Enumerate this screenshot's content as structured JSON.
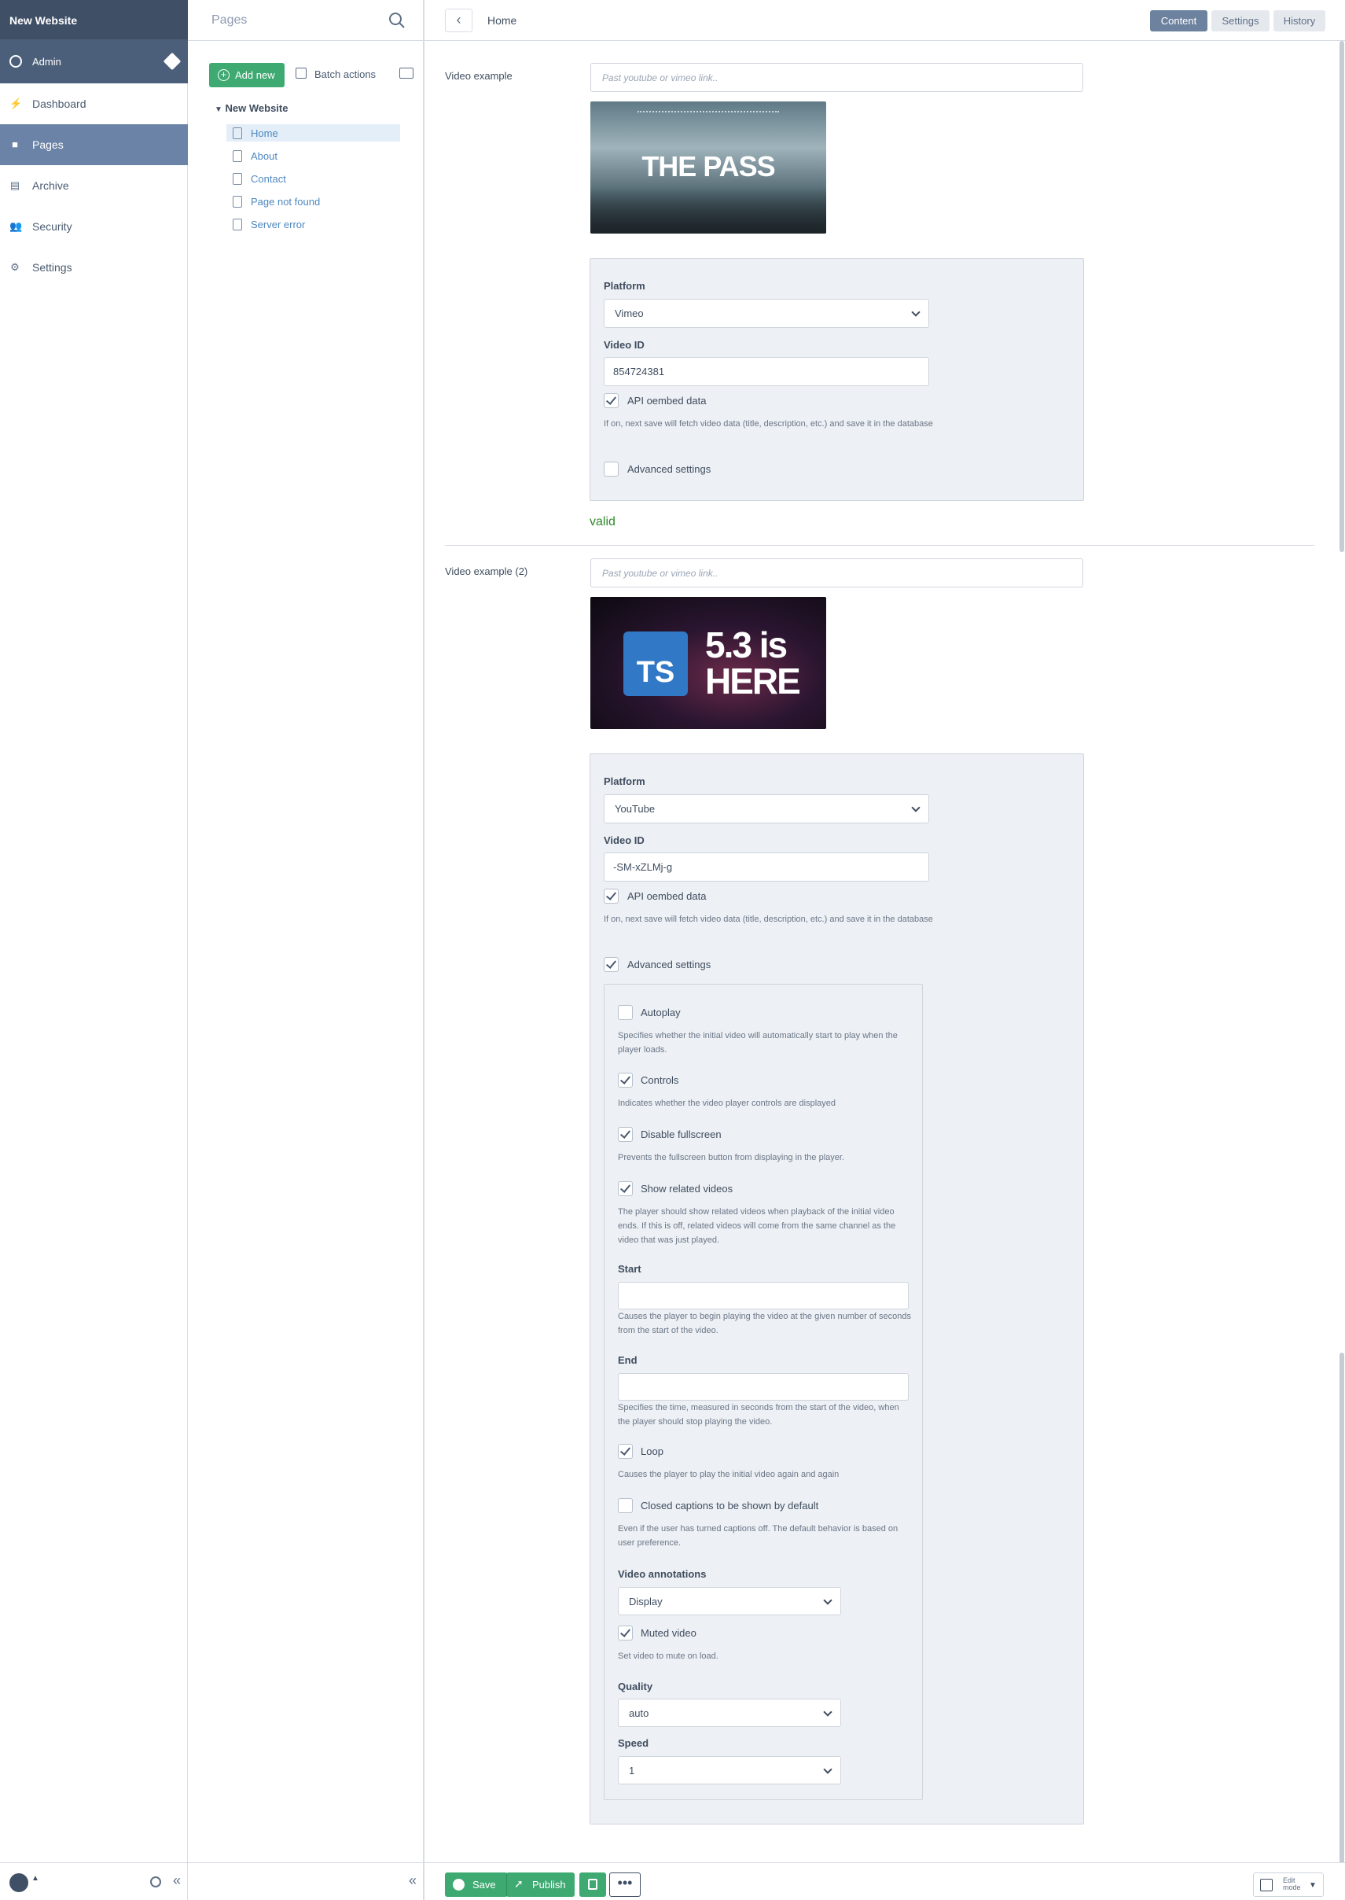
{
  "sidebar": {
    "site_name": "New Website",
    "user": "Admin",
    "items": [
      {
        "label": "Dashboard",
        "icon": "bolt-icon"
      },
      {
        "label": "Pages",
        "icon": "cube-icon"
      },
      {
        "label": "Archive",
        "icon": "archive-icon"
      },
      {
        "label": "Security",
        "icon": "users-icon"
      },
      {
        "label": "Settings",
        "icon": "gear-icon"
      }
    ]
  },
  "tree": {
    "title": "Pages",
    "add_new": "Add new",
    "batch_actions": "Batch actions",
    "root": "New Website",
    "nodes": [
      "Home",
      "About",
      "Contact",
      "Page not found",
      "Server error"
    ]
  },
  "topbar": {
    "breadcrumb": "Home",
    "tabs": [
      "Content",
      "Settings",
      "History"
    ]
  },
  "field1": {
    "label": "Video example",
    "placeholder": "Past youtube or vimeo link..",
    "thumb_title": "THE PASS",
    "platform_label": "Platform",
    "platform_value": "Vimeo",
    "video_id_label": "Video ID",
    "video_id": "854724381",
    "api_label": "API oembed data",
    "api_hint": "If on, next save will fetch video data (title, description, etc.) and save it in the database",
    "advanced_label": "Advanced settings",
    "status": "valid"
  },
  "field2": {
    "label": "Video example (2)",
    "placeholder": "Past youtube or vimeo link..",
    "thumb_badge": "TS",
    "thumb_text_line1": "5.3 is",
    "thumb_text_line2": "HERE",
    "platform_label": "Platform",
    "platform_value": "YouTube",
    "video_id_label": "Video ID",
    "video_id": "-SM-xZLMj-g",
    "api_label": "API oembed data",
    "api_hint": "If on, next save will fetch video data (title, description, etc.) and save it in the database",
    "advanced_label": "Advanced settings"
  },
  "advanced": {
    "autoplay": "Autoplay",
    "autoplay_hint": "Specifies whether the initial video will automatically start to play when the player loads.",
    "controls": "Controls",
    "controls_hint": "Indicates whether the video player controls are displayed",
    "disable_fs": "Disable fullscreen",
    "disable_fs_hint": "Prevents the fullscreen button from displaying in the player.",
    "related": "Show related videos",
    "related_hint": "The player should show related videos when playback of the initial video ends. If this is off, related videos will come from the same channel as the video that was just played.",
    "start": "Start",
    "start_hint": "Causes the player to begin playing the video at the given number of seconds from the start of the video.",
    "end": "End",
    "end_hint": "Specifies the time, measured in seconds from the start of the video, when the player should stop playing the video.",
    "loop": "Loop",
    "loop_hint": "Causes the player to play the initial video again and again",
    "cc": "Closed captions to be shown by default",
    "cc_hint": "Even if the user has turned captions off. The default behavior is based on user preference.",
    "annotations": "Video annotations",
    "annotations_value": "Display",
    "muted": "Muted video",
    "muted_hint": "Set video to mute on load.",
    "quality": "Quality",
    "quality_value": "auto",
    "speed": "Speed",
    "speed_value": "1"
  },
  "bottom": {
    "save": "Save",
    "publish": "Publish",
    "edit_mode_1": "Edit",
    "edit_mode_2": "mode",
    "collapse": "«"
  }
}
